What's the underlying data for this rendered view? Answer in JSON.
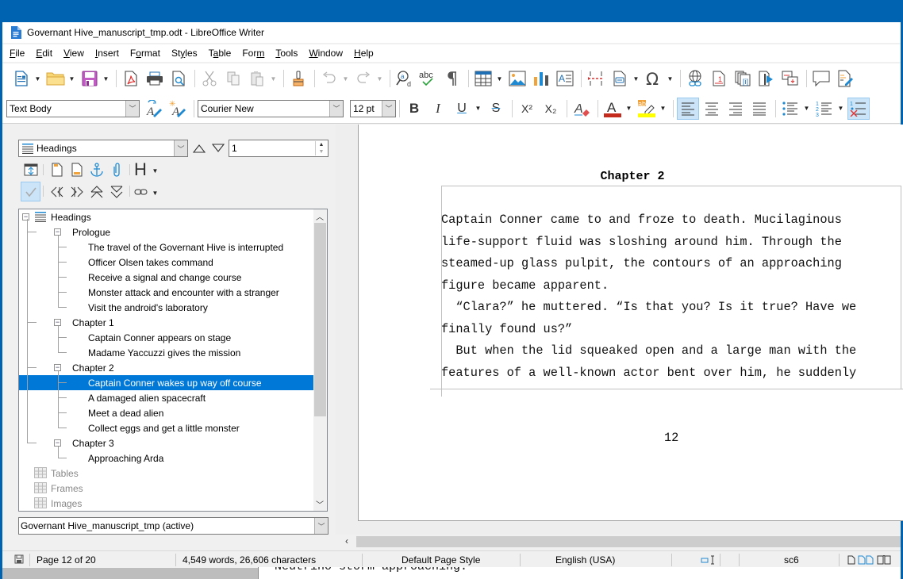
{
  "window": {
    "title": "Governant Hive_manuscript_tmp.odt - LibreOffice Writer",
    "accent_color": "#0063b1"
  },
  "menubar": {
    "items": [
      {
        "label": "File",
        "key": "F",
        "rest": "ile"
      },
      {
        "label": "Edit",
        "key": "E",
        "rest": "dit"
      },
      {
        "label": "View",
        "key": "V",
        "rest": "iew"
      },
      {
        "label": "Insert",
        "key": "I",
        "rest": "nsert"
      },
      {
        "label": "Format",
        "key": "o",
        "pre": "F",
        "rest": "rmat"
      },
      {
        "label": "Styles",
        "key": "y",
        "pre": "St",
        "rest": "les"
      },
      {
        "label": "Table",
        "key": "a",
        "pre": "T",
        "rest": "ble"
      },
      {
        "label": "Form",
        "key": "m",
        "pre": "For",
        "rest": ""
      },
      {
        "label": "Tools",
        "key": "T",
        "rest": "ools"
      },
      {
        "label": "Window",
        "key": "W",
        "rest": "indow"
      },
      {
        "label": "Help",
        "key": "H",
        "rest": "elp"
      }
    ]
  },
  "standard_toolbar": {
    "icons": [
      "new-document",
      "open-folder",
      "save",
      "export-pdf",
      "print",
      "print-preview",
      "cut",
      "copy",
      "paste",
      "clone-formatting",
      "undo",
      "redo",
      "find-replace",
      "spelling",
      "formatting-marks",
      "insert-table",
      "insert-image",
      "insert-chart",
      "insert-text-box",
      "insert-page-break",
      "insert-field",
      "insert-special-character",
      "insert-hyperlink",
      "insert-footnote",
      "insert-endnote",
      "insert-bookmark",
      "insert-cross-reference",
      "insert-comment",
      "track-changes"
    ]
  },
  "formatting_toolbar": {
    "paragraph_style": "Text Body",
    "font_name": "Courier New",
    "font_size": "12 pt",
    "bold_label": "B",
    "italic_label": "I",
    "underline_label": "U",
    "strike_label": "S",
    "superscript_label": "X²",
    "subscript_label": "X₂",
    "font_color": "#c42b1c",
    "highlight_color": "#ffff00",
    "align_left_active": true
  },
  "navigator": {
    "category": "Headings",
    "heading_level": "1",
    "tree": [
      {
        "label": "Headings",
        "level": 0,
        "type": "root"
      },
      {
        "label": "Prologue",
        "level": 1
      },
      {
        "label": "The travel of the Governant Hive is interrupted",
        "level": 2
      },
      {
        "label": "Officer Olsen takes command",
        "level": 2
      },
      {
        "label": "Receive a signal and change course",
        "level": 2
      },
      {
        "label": "Monster attack and encounter with a stranger",
        "level": 2
      },
      {
        "label": "Visit the android's laboratory",
        "level": 2
      },
      {
        "label": "Chapter 1",
        "level": 1
      },
      {
        "label": "Captain Conner appears on stage",
        "level": 2
      },
      {
        "label": "Madame Yaccuzzi gives the mission",
        "level": 2
      },
      {
        "label": "Chapter 2",
        "level": 1
      },
      {
        "label": "Captain Conner wakes up way off course",
        "level": 2,
        "selected": true
      },
      {
        "label": "A damaged alien spacecraft",
        "level": 2
      },
      {
        "label": "Meet a dead alien",
        "level": 2
      },
      {
        "label": "Collect eggs and get a little monster",
        "level": 2
      },
      {
        "label": "Chapter 3",
        "level": 1
      },
      {
        "label": "Approaching Arda",
        "level": 2
      },
      {
        "label": "Tables",
        "level": 0,
        "type": "category"
      },
      {
        "label": "Frames",
        "level": 0,
        "type": "category"
      },
      {
        "label": "Images",
        "level": 0,
        "type": "category"
      }
    ],
    "document_select": "Governant Hive_manuscript_tmp (active)",
    "selection_color": "#0078d7"
  },
  "document": {
    "heading": "Chapter 2",
    "lines": [
      "Captain Conner came to and froze to death. Mucilaginous",
      "life-support fluid was sloshing around him. Through the",
      "steamed-up glass pulpit, the contours of an approaching",
      "figure became apparent.",
      "  “Clara?” he muttered. “Is that you? Is it true? Have we",
      "finally found us?”",
      "  But when the lid squeaked open and a large man with the",
      "features of a well-known actor bent over him, he suddenly"
    ],
    "page_number": "12",
    "next_page_peek": "Neutrino storm approaching."
  },
  "statusbar": {
    "page": "Page 12 of 20",
    "word_count": "4,549 words, 26,606 characters",
    "page_style": "Default Page Style",
    "language": "English (USA)",
    "selection_mode": "sc6"
  }
}
